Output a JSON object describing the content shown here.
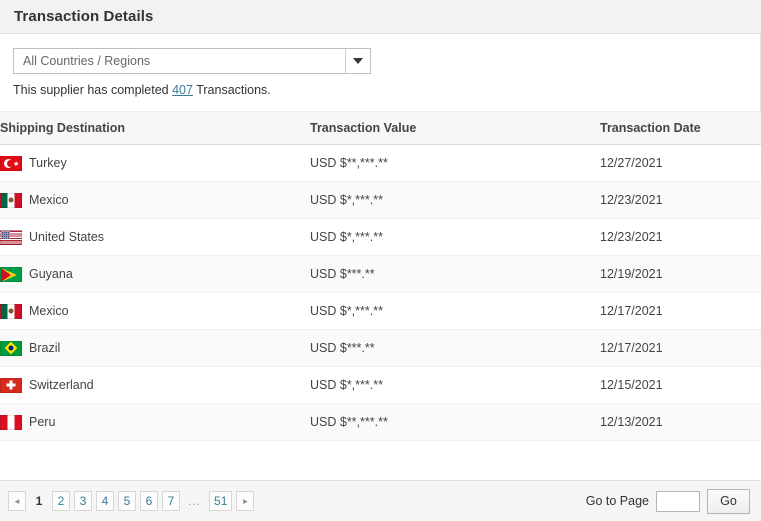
{
  "header": {
    "title": "Transaction Details"
  },
  "filter": {
    "selected": "All Countries / Regions",
    "arrow_icon": "chevron-down-icon"
  },
  "summary": {
    "prefix": "This supplier has completed ",
    "count": "407",
    "suffix": " Transactions."
  },
  "table": {
    "columns": [
      "Shipping Destination",
      "Transaction Value",
      "Transaction Date"
    ],
    "rows": [
      {
        "flag": "tr",
        "destination": "Turkey",
        "value": "USD $**,***.**",
        "date": "12/27/2021"
      },
      {
        "flag": "mx",
        "destination": "Mexico",
        "value": "USD $*,***.**",
        "date": "12/23/2021"
      },
      {
        "flag": "us",
        "destination": "United States",
        "value": "USD $*,***.**",
        "date": "12/23/2021"
      },
      {
        "flag": "gy",
        "destination": "Guyana",
        "value": "USD $***.**",
        "date": "12/19/2021"
      },
      {
        "flag": "mx",
        "destination": "Mexico",
        "value": "USD $*,***.**",
        "date": "12/17/2021"
      },
      {
        "flag": "br",
        "destination": "Brazil",
        "value": "USD $***.**",
        "date": "12/17/2021"
      },
      {
        "flag": "ch",
        "destination": "Switzerland",
        "value": "USD $*,***.**",
        "date": "12/15/2021"
      },
      {
        "flag": "pe",
        "destination": "Peru",
        "value": "USD $**,***.**",
        "date": "12/13/2021"
      }
    ]
  },
  "pagination": {
    "prev_label": "◂",
    "next_label": "▸",
    "pages": [
      "1",
      "2",
      "3",
      "4",
      "5",
      "6",
      "7"
    ],
    "ellipsis": "...",
    "last_page": "51",
    "current_page": "1",
    "goto_label": "Go to Page",
    "goto_value": "",
    "goto_placeholder": "",
    "go_label": "Go",
    "link_color": "#3a7d9a"
  }
}
